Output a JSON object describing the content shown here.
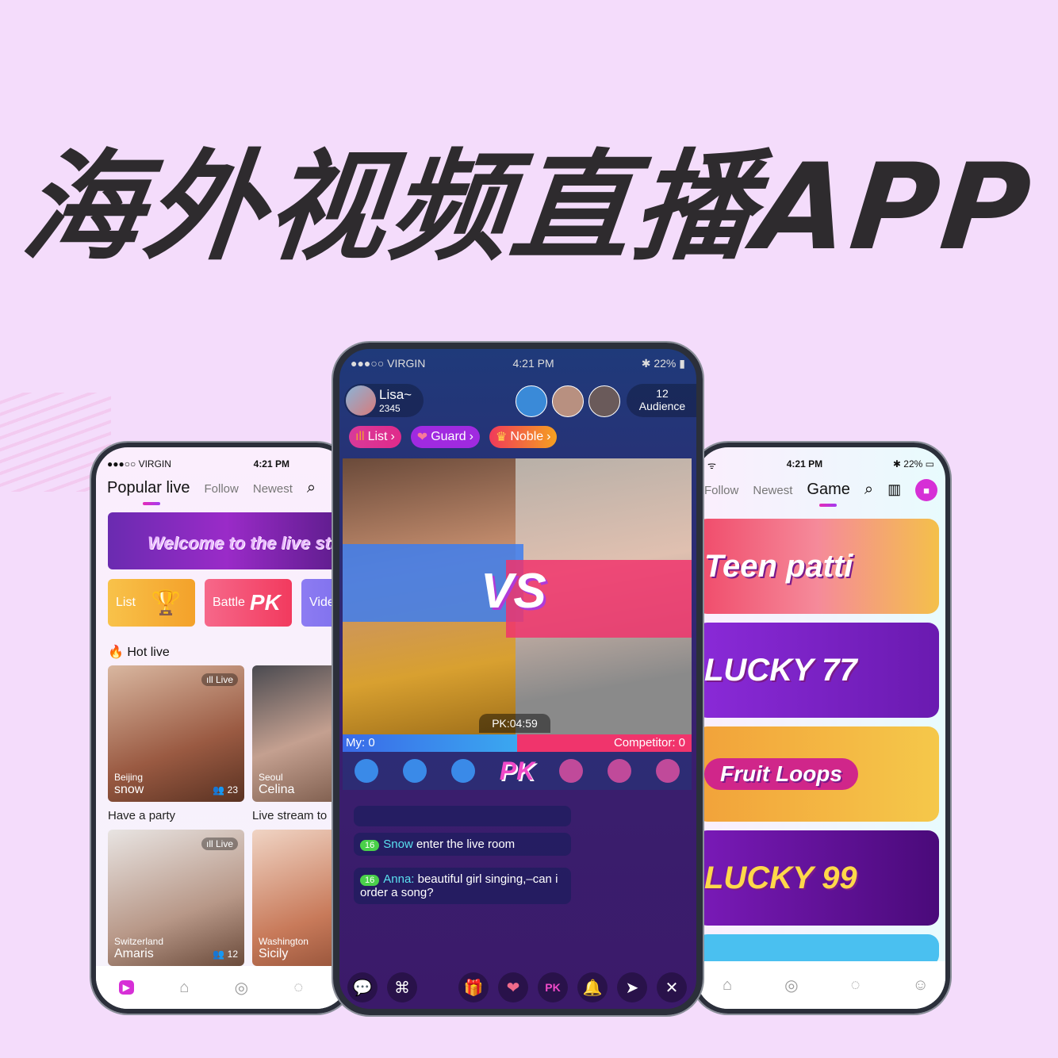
{
  "headline": "海外视频直播APP",
  "status": {
    "carrier": "●●●○○ VIRGIN",
    "time": "4:21 PM",
    "battery": "22%"
  },
  "left": {
    "tabs": [
      "Popular live",
      "Follow",
      "Newest"
    ],
    "banner": "Welcome to the live stream",
    "cards": [
      "List",
      "Battle",
      "Video"
    ],
    "pk_badge": "PK",
    "section": "Hot live",
    "live_badge": "Live",
    "streams": [
      {
        "city": "Beijing",
        "name": "snow",
        "count": "23",
        "caption": "Have a party"
      },
      {
        "city": "Seoul",
        "name": "Celina",
        "caption": "Live stream to"
      },
      {
        "city": "Switzerland",
        "name": "Amaris",
        "count": "12"
      },
      {
        "city": "Washington",
        "name": "Sicily"
      }
    ]
  },
  "center": {
    "host": {
      "name": "Lisa~",
      "id": "2345"
    },
    "audience": {
      "count": "12",
      "label": "Audience"
    },
    "pills": [
      "List",
      "Guard",
      "Noble"
    ],
    "vs": "VS",
    "timer": "PK:04:59",
    "my_score": "My: 0",
    "competitor_score": "Competitor: 0",
    "pk_label": "PK",
    "chat": [
      {
        "level": "16",
        "user": "Snow",
        "text": " enter the live room"
      },
      {
        "level": "16",
        "user": "Anna:",
        "text": " beautiful girl singing,–can i order a song?"
      }
    ],
    "colors": {
      "blue_team": "#3d7ef0",
      "red_team": "#f0346c"
    }
  },
  "right": {
    "tabs": [
      "Follow",
      "Newest",
      "Game"
    ],
    "games": [
      "Teen patti",
      "LUCKY 77",
      "Fruit Loops",
      "LUCKY 99"
    ]
  }
}
